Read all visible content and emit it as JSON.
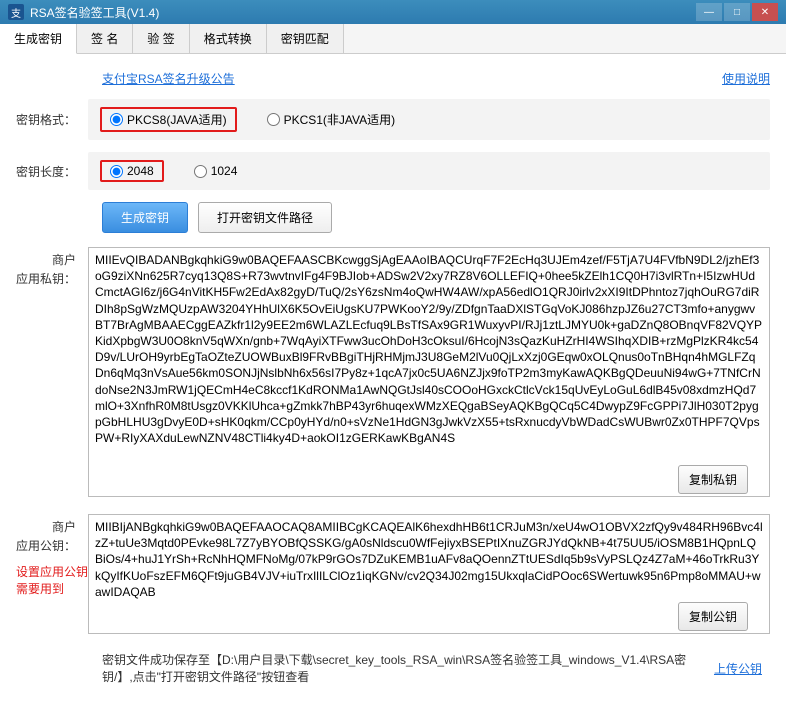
{
  "window": {
    "title": "RSA签名验签工具(V1.4)"
  },
  "tabs": {
    "items": [
      {
        "label": "生成密钥",
        "active": true
      },
      {
        "label": "签 名"
      },
      {
        "label": "验 签"
      },
      {
        "label": "格式转换"
      },
      {
        "label": "密钥匹配"
      }
    ]
  },
  "links": {
    "upgrade": "支付宝RSA签名升级公告",
    "usage": "使用说明",
    "upload": "上传公钥"
  },
  "form": {
    "format_label": "密钥格式：",
    "format_opts": {
      "pkcs8": "PKCS8(JAVA适用)",
      "pkcs1": "PKCS1(非JAVA适用)"
    },
    "length_label": "密钥长度：",
    "length_opts": {
      "l2048": "2048",
      "l1024": "1024"
    }
  },
  "buttons": {
    "generate": "生成密钥",
    "open_path": "打开密钥文件路径",
    "copy_priv": "复制私钥",
    "copy_pub": "复制公钥"
  },
  "keys": {
    "priv_label": "商户\n应用私钥：",
    "priv_value": "MIIEvQIBADANBgkqhkiG9w0BAQEFAASCBKcwggSjAgEAAoIBAQCUrqF7F2EcHq3UJEm4zef/F5TjA7U4FVfbN9DL2/jzhEf3oG9ziXNn625R7cyq13Q8S+R73wvtnvIFg4F9BJIob+ADSw2V2xy7RZ8V6OLLEFIQ+0hee5kZElh1CQ0H7i3vlRTn+I5IzwHUdCmctAGI6z/j6G4nVitKH5Fw2EdAx82gyD/TuQ/2sY6zsNm4oQwHW4AW/xpA56edlO1QRJ0irlv2xXI9ItDPhntoz7jqhOuRG7diRDIh8pSgWzMQUzpAW3204YHhUlX6K5OvEiUgsKU7PWKooY2/9y/ZDfgnTaaDXlSTGqVoKJ086hzpJZ6u27CT3mfo+anygwvBT7BrAgMBAAECggEAZkfr1l2y9EE2m6WLAZLEcfuq9LBsTfSAx9GR1WuxyvPI/RJj1ztLJMYU0k+gaDZnQ8OBnqVF82VQYPKidXpbgW3U0O8knV5qWXn/gnb+7WqAyiXTFww3ucOhDoH3cOksuI/6HcojN3sQazKuHZrHI4WSIhqXDIB+rzMgPlzKR4kc54D9v/LUrOH9yrbEgTaOZteZUOWBuxBl9FRvBBgiTHjRHMjmJ3U8GeM2lVu0QjLxXzj0GEqw0xOLQnus0oTnBHqn4hMGLFZqDn6qMq3nVsAue56km0SONJjNslbNh6x56sI7Py8z+1qcA7jx0c5UA6NZJjx9foTP2m3myKawAQKBgQDeuuNi94wG+7TNfCrNdoNse2N3JmRW1jQECmH4eC8kccf1KdRONMa1AwNQGtJsl40sCOOoHGxckCtlcVck15qUvEyLoGuL6dlB45v08xdmzHQd7mlO+3XnfhR0M8tUsgz0VKKlUhca+gZmkk7hBP43yr6huqexWMzXEQgaBSeyAQKBgQCq5C4DwypZ9FcGPPi7JlH030T2pygpGbHLHU3gDvyE0D+sHK0qkm/CCp0yHYd/n0+sVzNe1HdGN3gJwkVzX55+tsRxnucdyVbWDadCsWUBwr0Zx0THPF7QVpsPW+RIyXAXduLewNZNV48CTli4ky4D+aokOI1zGERKawKBgAN4S",
    "pub_label": "商户\n应用公钥：",
    "pub_value": "MIIBIjANBgkqhkiG9w0BAQEFAAOCAQ8AMIIBCgKCAQEAlK6hexdhHB6t1CRJuM3n/xeU4wO1OBVX2zfQy9v484RH96Bvc4lzZ+tuUe3Mqtd0PEvke98L7Z7yBYOBfQSSKG/gA0sNldscu0WfFejiyxBSEPtIXnuZGRJYdQkNB+4t75UU5/iOSM8B1HQpnLQBiOs/4+huJ1YrSh+RcNhHQMFNoMg/07kP9rGOs7DZuKEMB1uAFv8aQOennZTtUESdIq5b9sVyPSLQz4Z7aM+46oTrkRu3YkQyIfKUoFszEFM6QFt9juGB4VJV+iuTrxIlILClOz1iqKGNv/cv2Q34J02mg15UkxqlaCidPOoc6SWertuwk95n6Pmp8oMMAU+wawIDAQAB",
    "red_note": "设置应用公钥\n需要用到"
  },
  "bottom": {
    "text": "密钥文件成功保存至【D:\\用户目录\\下载\\secret_key_tools_RSA_win\\RSA签名验签工具_windows_V1.4\\RSA密钥/】,点击\"打开密钥文件路径\"按钮查看"
  }
}
